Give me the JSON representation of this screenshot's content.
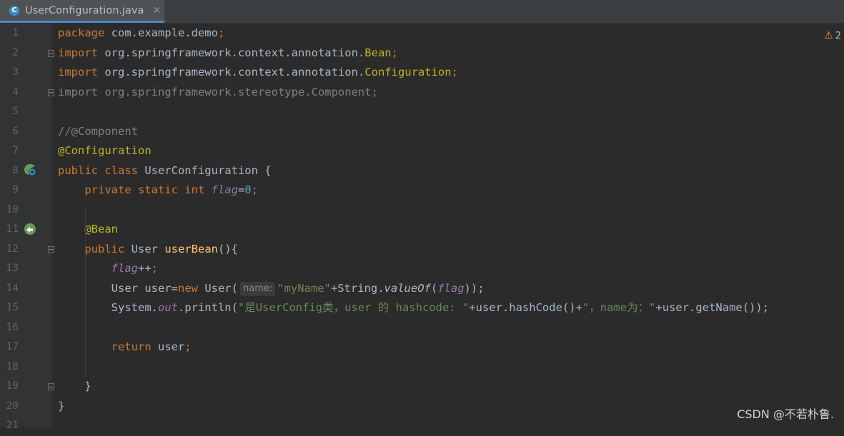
{
  "tab": {
    "icon": "class-c-icon",
    "title": "UserConfiguration.java",
    "close": "✕"
  },
  "inspection": {
    "icon": "warning-triangle-icon",
    "count": "2"
  },
  "lines": [
    {
      "n": "1",
      "text": "package com.example.demo;"
    },
    {
      "n": "2",
      "text": "import org.springframework.context.annotation.Bean;"
    },
    {
      "n": "3",
      "text": "import org.springframework.context.annotation.Configuration;"
    },
    {
      "n": "4",
      "text": "import org.springframework.stereotype.Component;"
    },
    {
      "n": "5",
      "text": ""
    },
    {
      "n": "6",
      "text": "//@Component"
    },
    {
      "n": "7",
      "text": "@Configuration"
    },
    {
      "n": "8",
      "text": "public class UserConfiguration {"
    },
    {
      "n": "9",
      "text": "    private static int flag=0;"
    },
    {
      "n": "10",
      "text": ""
    },
    {
      "n": "11",
      "text": "    @Bean"
    },
    {
      "n": "12",
      "text": "    public User userBean(){"
    },
    {
      "n": "13",
      "text": "        flag++;"
    },
    {
      "n": "14",
      "text": "        User user=new User( name: \"myName\"+String.valueOf(flag));"
    },
    {
      "n": "15",
      "text": "        System.out.println(\"是UserConfig类，user 的 hashcode: \"+user.hashCode()+\"，name为：\"+user.getName());"
    },
    {
      "n": "16",
      "text": ""
    },
    {
      "n": "17",
      "text": "        return user;"
    },
    {
      "n": "18",
      "text": ""
    },
    {
      "n": "19",
      "text": "    }"
    },
    {
      "n": "20",
      "text": "}"
    },
    {
      "n": "21",
      "text": ""
    }
  ],
  "tokens": {
    "l1": [
      "package",
      " com.example.demo",
      ";"
    ],
    "l2": [
      "import",
      " org.springframework.context.annotation.",
      "Bean",
      ";"
    ],
    "l3": [
      "import",
      " org.springframework.context.annotation.",
      "Configuration",
      ";"
    ],
    "l4": "import org.springframework.stereotype.Component;",
    "l6": "//@Component",
    "l7": "@Configuration",
    "l8": [
      "public class",
      " UserConfiguration {"
    ],
    "l9": [
      "private static int",
      "flag",
      "=",
      "0",
      ";"
    ],
    "l11": "@Bean",
    "l12": [
      "public",
      " User ",
      "userBean",
      "(){"
    ],
    "l13": [
      "flag",
      "++",
      ";"
    ],
    "l14": [
      "User user=",
      "new",
      " User(",
      "name:",
      "\"myName\"",
      "+String.",
      "valueOf",
      "(",
      "flag",
      "));"
    ],
    "l15": [
      "System.",
      "out",
      ".println(",
      "\"是UserConfig类，user 的 hashcode: \"",
      "+user.hashCode()+",
      "\"，name为：\"",
      "+user.getName());"
    ],
    "l17": [
      "return",
      " user",
      ";"
    ],
    "l19": "}",
    "l20": "}"
  },
  "gutter_icons": {
    "line8": "spring-bean-class-icon",
    "line11": "spring-bean-method-icon"
  },
  "watermark": "CSDN @不若朴鲁."
}
